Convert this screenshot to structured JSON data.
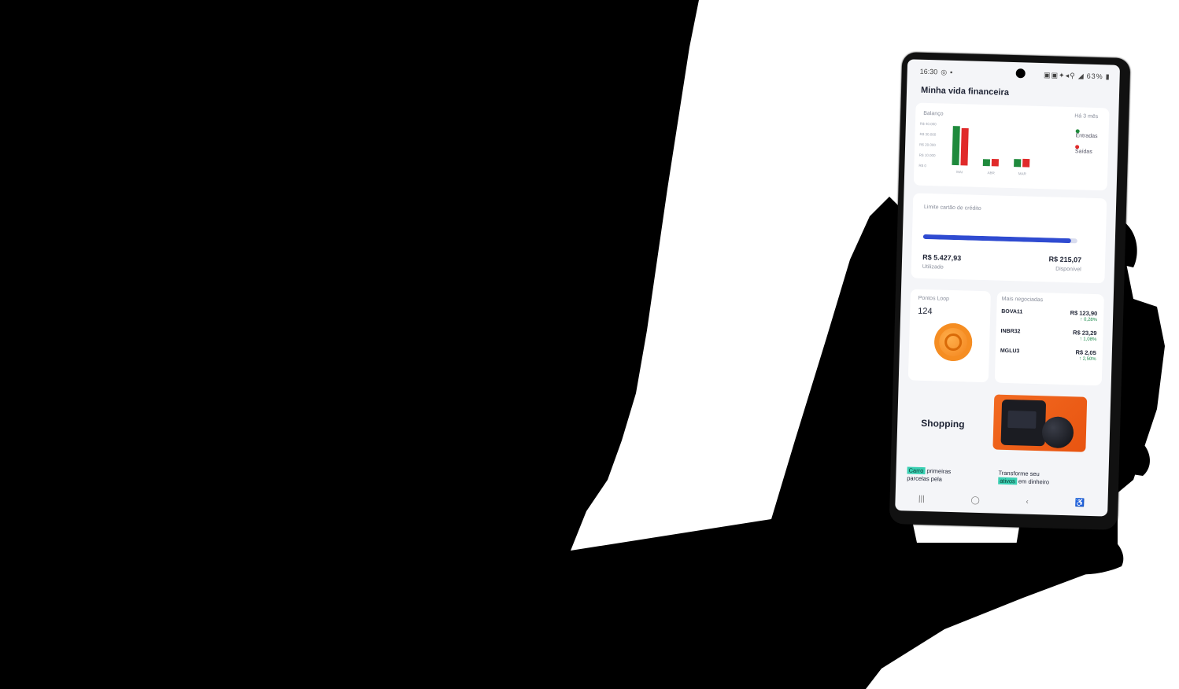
{
  "status": {
    "time": "16:30",
    "battery": "63%"
  },
  "app": {
    "title": "Minha vida financeira"
  },
  "balance_card": {
    "label": "Balanço",
    "period": "Há 3 mês",
    "y_ticks": [
      "R$ 40.000",
      "R$ 30.000",
      "R$ 20.000",
      "R$ 10.000",
      "R$ 0"
    ],
    "legend_in": "Entradas",
    "legend_out": "Saídas",
    "colors": {
      "in": "#1f8a3c",
      "out": "#e02a2a"
    }
  },
  "chart_data": {
    "type": "bar",
    "categories": [
      "MAI",
      "ABR",
      "MAR"
    ],
    "series": [
      {
        "name": "Entradas",
        "values": [
          40000,
          7000,
          8000
        ]
      },
      {
        "name": "Saídas",
        "values": [
          38000,
          7500,
          8500
        ]
      }
    ],
    "ylim": [
      0,
      45000
    ]
  },
  "credit_card": {
    "label": "Limite cartão de crédito",
    "used_amount": "R$ 5.427,93",
    "used_label": "Utilizado",
    "available_amount": "R$ 215,07",
    "available_label": "Disponível",
    "used_fraction": 0.96
  },
  "points": {
    "label": "Pontos Loop",
    "value": "124"
  },
  "stocks": {
    "label": "Mais negociadas",
    "items": [
      {
        "ticker": "BOVA11",
        "price": "R$ 123,90",
        "change": "↑ 0,28%"
      },
      {
        "ticker": "INBR32",
        "price": "R$ 23,29",
        "change": "↑ 1,08%"
      },
      {
        "ticker": "MGLU3",
        "price": "R$ 2,05",
        "change": "↑ 2,50%"
      }
    ]
  },
  "shopping": {
    "title": "Shopping"
  },
  "promos": [
    {
      "highlight": "Carro",
      "line1": " primeiras",
      "line2": "parcelas pela"
    },
    {
      "line1": "Transforme seu",
      "highlight": "ativos",
      "line2": " em dinheiro"
    }
  ]
}
